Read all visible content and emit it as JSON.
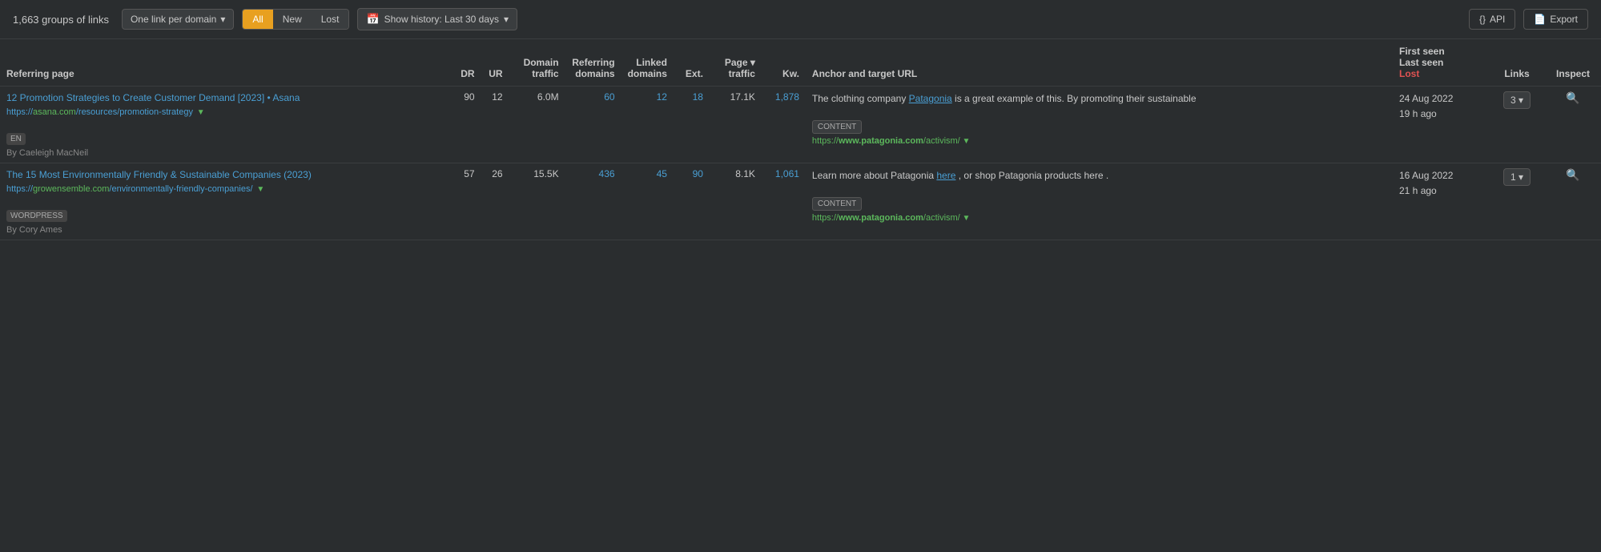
{
  "toolbar": {
    "groups_count": "1,663 groups of links",
    "domain_filter_label": "One link per domain",
    "domain_filter_chevron": "▾",
    "filter_all": "All",
    "filter_new": "New",
    "filter_lost": "Lost",
    "history_icon": "📅",
    "history_label": "Show history: Last 30 days",
    "history_chevron": "▾",
    "api_label": "API",
    "api_icon": "{}",
    "export_label": "Export",
    "export_icon": "📄"
  },
  "table": {
    "columns": [
      {
        "key": "referring_page",
        "label": "Referring page"
      },
      {
        "key": "dr",
        "label": "DR"
      },
      {
        "key": "ur",
        "label": "UR"
      },
      {
        "key": "domain_traffic",
        "label": "Domain\ntraffic"
      },
      {
        "key": "referring_domains",
        "label": "Referring\ndomains"
      },
      {
        "key": "linked_domains",
        "label": "Linked\ndomains"
      },
      {
        "key": "ext",
        "label": "Ext."
      },
      {
        "key": "page_traffic",
        "label": "Page ▾\ntraffic",
        "sortable": true
      },
      {
        "key": "kw",
        "label": "Kw."
      },
      {
        "key": "anchor_target",
        "label": "Anchor and target URL"
      },
      {
        "key": "first_seen",
        "label": "First seen\nLast seen\nLost",
        "has_lost": true
      },
      {
        "key": "links",
        "label": "Links"
      },
      {
        "key": "inspect",
        "label": "Inspect"
      }
    ],
    "rows": [
      {
        "id": "row-1",
        "page_title": "12 Promotion Strategies to Create Customer Demand [2023] • Asana",
        "page_url_prefix": "https://",
        "page_url_domain": "asana.com",
        "page_url_path": "/resources/p\nromotion-strategy",
        "page_url_chevron": "▼",
        "badge": "EN",
        "author": "By Caeleigh MacNeil",
        "dr": "90",
        "ur": "12",
        "domain_traffic": "6.0M",
        "referring_domains": "60",
        "linked_domains": "12",
        "ext": "18",
        "page_traffic": "17.1K",
        "kw": "1,878",
        "anchor_text_before": "The clothing company ",
        "anchor_link": "Patagonia",
        "anchor_text_after": " is a great example of this. By promoting their sustainable",
        "content_badge": "CONTENT",
        "target_url_prefix": "https://",
        "target_url_domain": "www.patagonia.com",
        "target_url_path": "/activism/",
        "target_url_chevron": "▼",
        "first_seen": "24 Aug 2022",
        "last_seen": "19 h ago",
        "links_count": "3",
        "links_chevron": "▾"
      },
      {
        "id": "row-2",
        "page_title": "The 15 Most Environmentally Friendly & Sustainable Companies (2023)",
        "page_url_prefix": "https://",
        "page_url_domain": "growensemble.com",
        "page_url_path": "/en\nvironmentally-friendly-compani\nes/",
        "page_url_chevron": "▼",
        "badge": "WORDPRESS",
        "author": "By Cory Ames",
        "dr": "57",
        "ur": "26",
        "domain_traffic": "15.5K",
        "referring_domains": "436",
        "linked_domains": "45",
        "ext": "90",
        "page_traffic": "8.1K",
        "kw": "1,061",
        "anchor_text_before": "Learn more about Patagonia ",
        "anchor_link": "here",
        "anchor_text_after": " , or shop Patagonia products here .",
        "content_badge": "CONTENT",
        "target_url_prefix": "https://",
        "target_url_domain": "www.patagonia.com",
        "target_url_path": "/activism/",
        "target_url_chevron": "▼",
        "first_seen": "16 Aug 2022",
        "last_seen": "21 h ago",
        "links_count": "1",
        "links_chevron": "▾"
      }
    ],
    "lost_label": "Lost"
  }
}
